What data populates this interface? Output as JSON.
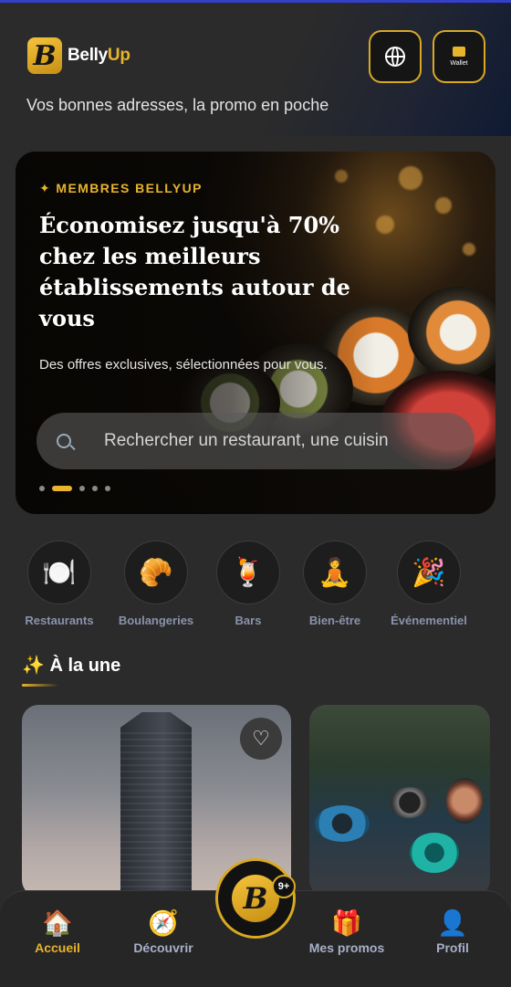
{
  "app": {
    "name_part1": "Belly",
    "name_part2": "Up",
    "logo_letter": "B"
  },
  "header": {
    "tagline": "Vos bonnes adresses, la promo en poche",
    "globe_button_icon": "globe-icon",
    "wallet_button_icon": "wallet-icon",
    "wallet_label": "Wallet"
  },
  "hero": {
    "eyebrow": "✦ MEMBRES BELLYUP",
    "title": "Économisez jusqu'à 70% chez les meilleurs établissements autour de vous",
    "subtitle": "Des offres exclusives, sélectionnées pour vous.",
    "search_placeholder": "Rechercher un restaurant, une cuisin",
    "carousel": {
      "count": 5,
      "active_index": 1
    }
  },
  "categories": [
    {
      "icon": "plate-icon",
      "glyph": "🍽️",
      "label": "Restaurants"
    },
    {
      "icon": "croissant-icon",
      "glyph": "🥐",
      "label": "Boulangeries"
    },
    {
      "icon": "cocktail-icon",
      "glyph": "🍹",
      "label": "Bars"
    },
    {
      "icon": "meditation-icon",
      "glyph": "🧘",
      "label": "Bien-être"
    },
    {
      "icon": "party-popper-icon",
      "glyph": "🎉",
      "label": "Événementiel"
    }
  ],
  "featured": {
    "title": "✨ À la une",
    "cards": [
      {
        "image": "skyscraper",
        "favorite_icon": "heart-icon"
      },
      {
        "image": "floating-market"
      }
    ]
  },
  "nav": {
    "items": [
      {
        "icon": "home-icon",
        "glyph": "🏠",
        "label": "Accueil",
        "active": true
      },
      {
        "icon": "compass-icon",
        "glyph": "🧭",
        "label": "Découvrir",
        "active": false
      },
      {
        "icon": "gift-icon",
        "glyph": "🎁",
        "label": "Mes promos",
        "active": false
      },
      {
        "icon": "profile-icon",
        "glyph": "👤",
        "label": "Profil",
        "active": false
      }
    ],
    "center_badge": "9+"
  },
  "colors": {
    "accent": "#e8b42c",
    "background": "#2b2b2b",
    "nav_inactive": "#a7b0c8"
  }
}
